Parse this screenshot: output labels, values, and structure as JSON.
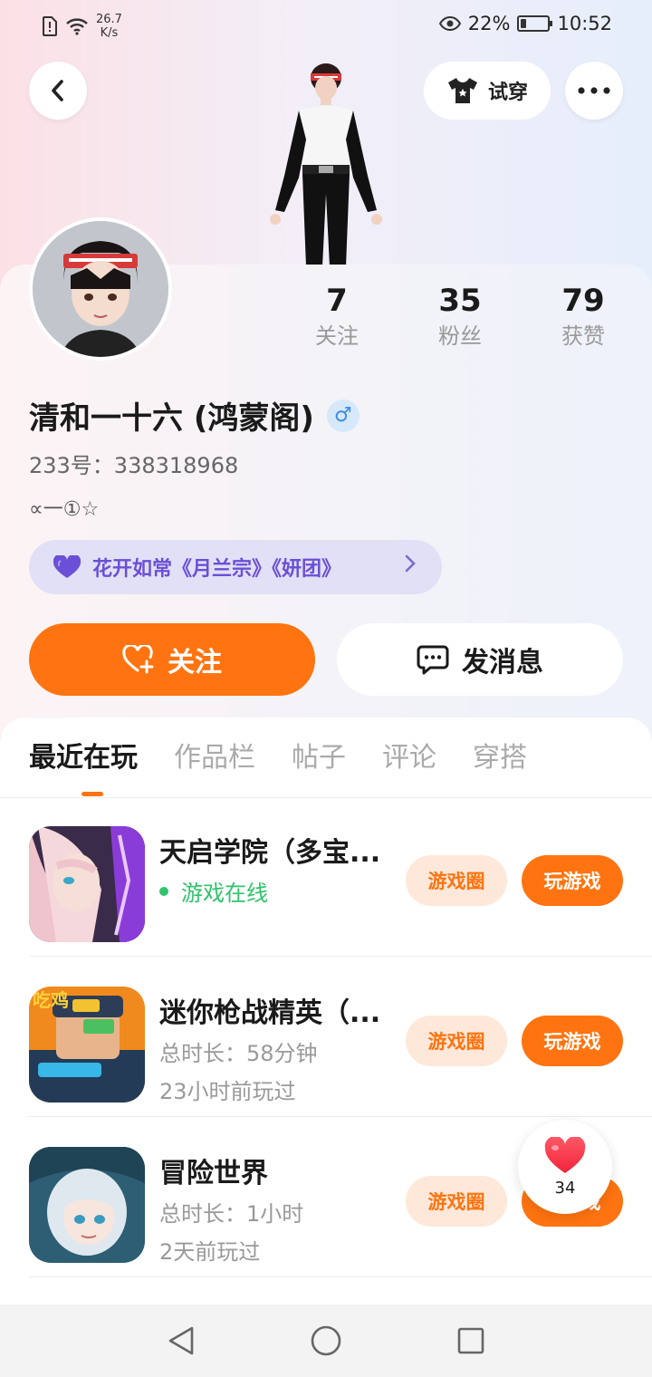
{
  "status_bar": {
    "net_speed_value": "26.7",
    "net_speed_unit": "K/s",
    "battery_percent": "22%",
    "battery_level": 0.22,
    "time": "10:52"
  },
  "header": {
    "try_on_label": "试穿"
  },
  "profile": {
    "stats": [
      {
        "value": "7",
        "label": "关注"
      },
      {
        "value": "35",
        "label": "粉丝"
      },
      {
        "value": "79",
        "label": "获赞"
      }
    ],
    "username": "清和一十六 (鸿蒙阁)",
    "gender_symbol": "♂",
    "user_id": "233号：338318968",
    "signature": "∝一①☆",
    "guild_text": "花开如常《月兰宗》《妍团》",
    "follow_label": "关注",
    "message_label": "发消息"
  },
  "tabs": [
    "最近在玩",
    "作品栏",
    "帖子",
    "评论",
    "穿搭"
  ],
  "games": [
    {
      "name": "天启学院（多宝...",
      "line1": "游戏在线",
      "line2": "",
      "circle_label": "游戏圈",
      "play_label": "玩游戏",
      "online": true
    },
    {
      "name": "迷你枪战精英（...",
      "line1": "总时长：58分钟",
      "line2": "23小时前玩过",
      "circle_label": "游戏圈",
      "play_label": "玩游戏",
      "online": false
    },
    {
      "name": "冒险世界",
      "line1": "总时长：1小时",
      "line2": "2天前玩过",
      "circle_label": "游戏圈",
      "play_label": "玩游戏",
      "online": false
    }
  ],
  "like_float": {
    "count": "34"
  },
  "colors": {
    "accent": "#ff7410",
    "accent_light": "#fde8da",
    "online": "#2fc36b",
    "guild_bg": "#e2e0f6",
    "guild_text": "#6b4fd6"
  }
}
